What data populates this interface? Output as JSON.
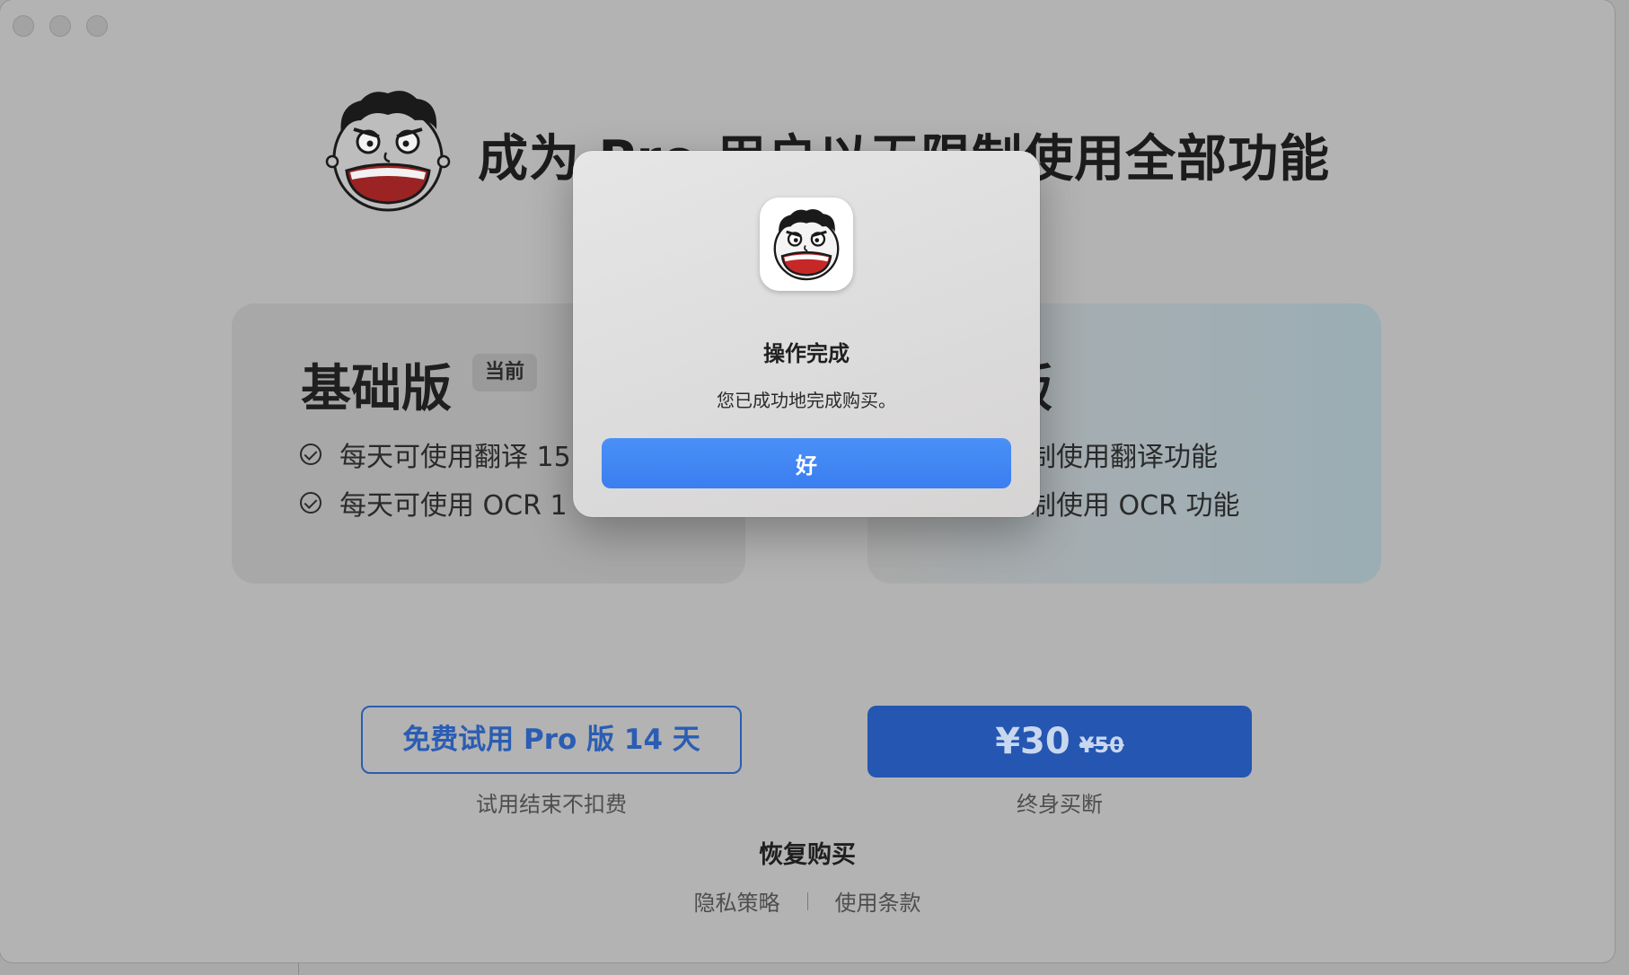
{
  "window": {
    "traffic_lights": [
      "close",
      "minimize",
      "zoom"
    ]
  },
  "header": {
    "title": "成为 Pro 用户以无限制使用全部功能",
    "avatar_icon": "cartoon-face-icon"
  },
  "plans": {
    "basic": {
      "title": "基础版",
      "badge": "当前",
      "features": [
        "每天可使用翻译 15",
        "每天可使用 OCR 1"
      ]
    },
    "pro": {
      "title": "版",
      "features": [
        "制使用翻译功能",
        "制使用 OCR 功能"
      ]
    }
  },
  "actions": {
    "trial_label": "免费试用 Pro 版 14 天",
    "trial_sub": "试用结束不扣费",
    "price": "¥30",
    "old_price": "¥50",
    "buy_sub": "终身买断",
    "restore": "恢复购买",
    "privacy": "隐私策略",
    "terms": "使用条款"
  },
  "dialog": {
    "title": "操作完成",
    "message": "您已成功地完成购买。",
    "ok": "好"
  },
  "colors": {
    "accent_blue": "#2456b2",
    "dialog_button": "#3a7ef0",
    "face_mouth": "#9b2323"
  }
}
